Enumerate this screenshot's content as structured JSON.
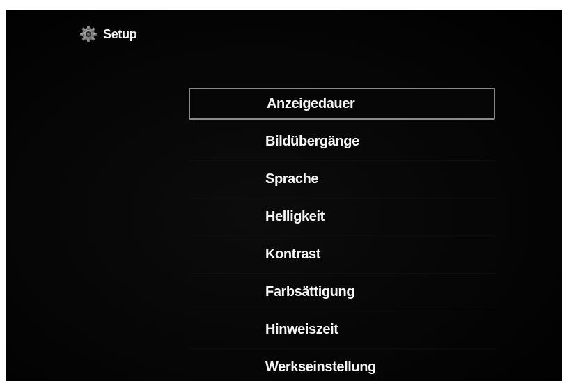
{
  "header": {
    "icon": "gear-icon",
    "title": "Setup"
  },
  "menu": {
    "selected_index": 0,
    "items": [
      {
        "label": "Anzeigedauer"
      },
      {
        "label": "Bildübergänge"
      },
      {
        "label": "Sprache"
      },
      {
        "label": "Helligkeit"
      },
      {
        "label": "Kontrast"
      },
      {
        "label": "Farbsättigung"
      },
      {
        "label": "Hinweiszeit"
      },
      {
        "label": "Werkseinstellung"
      }
    ]
  },
  "colors": {
    "background": "#000000",
    "text": "#f5f5f5",
    "selection_border": "#8a8a8a"
  }
}
